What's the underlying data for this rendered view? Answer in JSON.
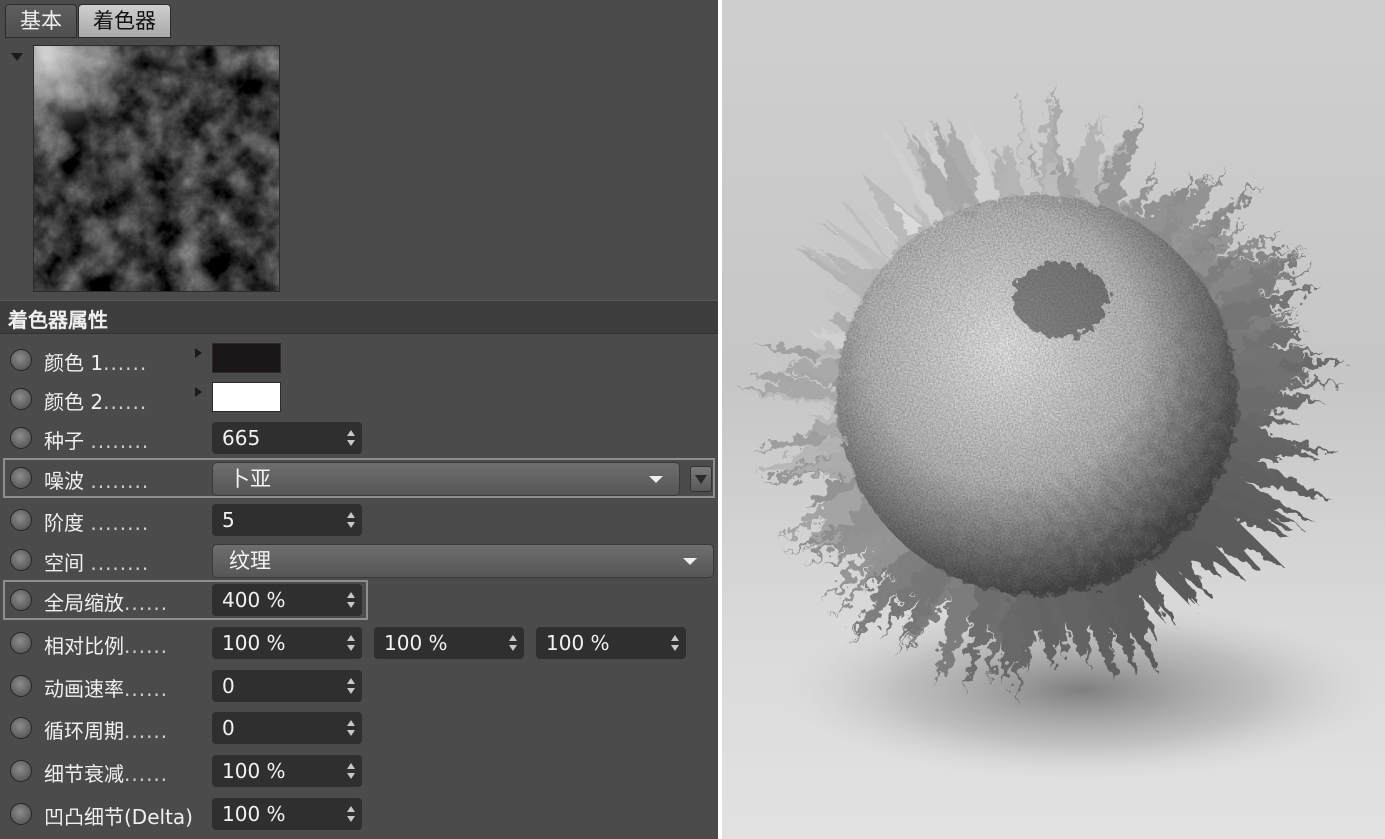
{
  "tabs": [
    {
      "label": "基本",
      "active": false
    },
    {
      "label": "着色器",
      "active": true
    }
  ],
  "section": {
    "title": "着色器属性"
  },
  "params": {
    "color1": {
      "label": "颜色 1",
      "dots": "......",
      "swatch": "#1a1617"
    },
    "color2": {
      "label": "颜色 2",
      "dots": "......",
      "swatch": "#ffffff"
    },
    "seed": {
      "label": "种子",
      "dots": "........",
      "value": "665"
    },
    "noise": {
      "label": "噪波",
      "dots": "........",
      "value": "卜亚"
    },
    "octaves": {
      "label": "阶度",
      "dots": "........",
      "value": "5"
    },
    "space": {
      "label": "空间",
      "dots": "........",
      "value": "纹理"
    },
    "global_scale": {
      "label": "全局缩放",
      "dots": "......",
      "value": "400 %"
    },
    "relative_scale": {
      "label": "相对比例",
      "dots": "......",
      "values": [
        "100 %",
        "100 %",
        "100 %"
      ]
    },
    "animation_speed": {
      "label": "动画速率",
      "dots": "......",
      "value": "0"
    },
    "loop_period": {
      "label": "循环周期",
      "dots": "......",
      "value": "0"
    },
    "detail_attenuation": {
      "label": "细节衰减",
      "dots": "......",
      "value": "100 %"
    },
    "delta": {
      "label": "凹凸细节(Delta)",
      "dots": "",
      "value": "100 %"
    }
  },
  "colors": {
    "panel": "#4b4b4b",
    "field": "#2f2f2f",
    "section": "#3d3d3d"
  }
}
